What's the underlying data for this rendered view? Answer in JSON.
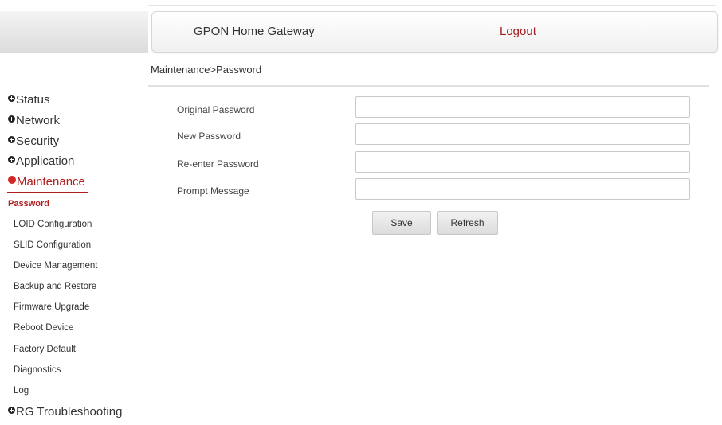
{
  "header": {
    "title": "GPON Home Gateway",
    "logout_label": "Logout"
  },
  "breadcrumb": "Maintenance>Password",
  "sidebar": {
    "menus": [
      {
        "label": "Status"
      },
      {
        "label": "Network"
      },
      {
        "label": "Security"
      },
      {
        "label": "Application"
      },
      {
        "label": "Maintenance",
        "active": true
      }
    ],
    "submenu": [
      {
        "label": "Password",
        "active": true
      },
      {
        "label": "LOID Configuration"
      },
      {
        "label": "SLID Configuration"
      },
      {
        "label": "Device Management"
      },
      {
        "label": "Backup and Restore"
      },
      {
        "label": "Firmware Upgrade"
      },
      {
        "label": "Reboot Device"
      },
      {
        "label": "Factory Default"
      },
      {
        "label": "Diagnostics"
      },
      {
        "label": "Log"
      }
    ],
    "last_menu": {
      "label": "RG Troubleshooting"
    }
  },
  "form": {
    "original_password": {
      "label": "Original Password",
      "value": ""
    },
    "new_password": {
      "label": "New Password",
      "value": ""
    },
    "reenter_password": {
      "label": "Re-enter Password",
      "value": ""
    },
    "prompt_message": {
      "label": "Prompt Message",
      "value": ""
    }
  },
  "buttons": {
    "save": "Save",
    "refresh": "Refresh"
  },
  "colors": {
    "accent_red": "#b01e1e",
    "border": "#c9c9c9"
  }
}
